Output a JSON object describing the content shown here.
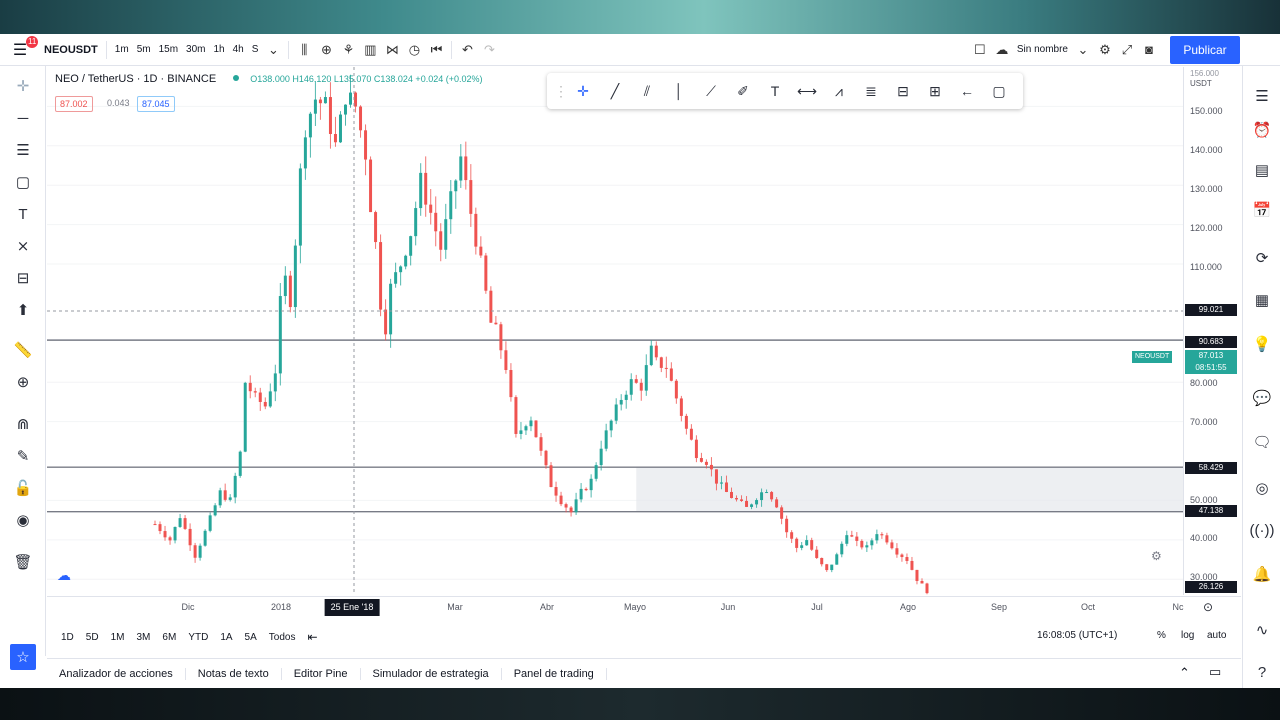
{
  "header": {
    "symbol": "NEOUSDT",
    "notification_count": "11",
    "intervals": [
      "1m",
      "5m",
      "15m",
      "30m",
      "1h",
      "4h",
      "S"
    ],
    "layout_name": "Sin nombre",
    "publish_label": "Publicar"
  },
  "legend": {
    "title": "NEO / TetherUS · 1D · BINANCE",
    "ohlc": "O138.000 H146.120 L135.070 C138.024 +0.024 (+0.02%)",
    "bid": "87.002",
    "spread": "0.043",
    "ask": "87.045"
  },
  "price_axis": {
    "currency": "USDT",
    "top_tag": "156.000",
    "labels": [
      "150.000",
      "140.000",
      "130.000",
      "120.000",
      "110.000",
      "80.000",
      "70.000",
      "50.000",
      "40.000",
      "30.000"
    ],
    "crosshair_price": "99.021",
    "level_tags": [
      "90.683",
      "58.429",
      "47.138"
    ],
    "bottom_tag": "26.126",
    "last_price": "87.013",
    "countdown": "08:51:55",
    "symbol_tag": "NEOUSDT"
  },
  "time_axis": {
    "labels": [
      "Dic",
      "2018",
      "Mar",
      "Abr",
      "Mayo",
      "Jun",
      "Jul",
      "Ago",
      "Sep",
      "Oct",
      "Nc"
    ],
    "crosshair_date": "25 Ene '18"
  },
  "range_bar": {
    "ranges": [
      "1D",
      "5D",
      "1M",
      "3M",
      "6M",
      "YTD",
      "1A",
      "5A",
      "Todos"
    ],
    "clock": "16:08:05 (UTC+1)",
    "percent_label": "%",
    "log_label": "log",
    "auto_label": "auto"
  },
  "bottom_tabs": [
    "Analizador de acciones",
    "Notas de texto",
    "Editor Pine",
    "Simulador de estrategia",
    "Panel de trading"
  ],
  "colors": {
    "up": "#26a69a",
    "down": "#ef5350",
    "accent": "#2962ff",
    "badge": "#f23645"
  },
  "chart_data": {
    "type": "candlestick",
    "ylim": [
      26,
      160
    ],
    "x_labels": [
      "Dic",
      "2018",
      "Mar",
      "Abr",
      "Mayo",
      "Jun",
      "Jul",
      "Ago",
      "Sep",
      "Oct",
      "Nc"
    ],
    "horizontal_levels": [
      90.683,
      58.429,
      47.138
    ],
    "shaded_zone": [
      47.138,
      58.429
    ],
    "price_path": [
      [
        0,
        44
      ],
      [
        3,
        40
      ],
      [
        5,
        46
      ],
      [
        8,
        36
      ],
      [
        10,
        42
      ],
      [
        13,
        52
      ],
      [
        15,
        50
      ],
      [
        17,
        62
      ],
      [
        18,
        80
      ],
      [
        20,
        76
      ],
      [
        22,
        74
      ],
      [
        24,
        83
      ],
      [
        25,
        100
      ],
      [
        26,
        106
      ],
      [
        27,
        101
      ],
      [
        28,
        116
      ],
      [
        29,
        133
      ],
      [
        30,
        145
      ],
      [
        32,
        152
      ],
      [
        34,
        150
      ],
      [
        36,
        140
      ],
      [
        37,
        146
      ],
      [
        38,
        153
      ],
      [
        40,
        150
      ],
      [
        42,
        138
      ],
      [
        43,
        125
      ],
      [
        44,
        115
      ],
      [
        45,
        100
      ],
      [
        46,
        94
      ],
      [
        47,
        104
      ],
      [
        49,
        110
      ],
      [
        51,
        118
      ],
      [
        53,
        131
      ],
      [
        55,
        123
      ],
      [
        57,
        114
      ],
      [
        59,
        126
      ],
      [
        61,
        137
      ],
      [
        63,
        123
      ],
      [
        65,
        110
      ],
      [
        67,
        95
      ],
      [
        68,
        93
      ],
      [
        70,
        84
      ],
      [
        72,
        66
      ],
      [
        74,
        70
      ],
      [
        75,
        71
      ],
      [
        77,
        62
      ],
      [
        79,
        54
      ],
      [
        81,
        50
      ],
      [
        83,
        47
      ],
      [
        85,
        52
      ],
      [
        87,
        55
      ],
      [
        89,
        64
      ],
      [
        91,
        70
      ],
      [
        93,
        76
      ],
      [
        95,
        80
      ],
      [
        97,
        79
      ],
      [
        99,
        88
      ],
      [
        100,
        85
      ],
      [
        102,
        84
      ],
      [
        104,
        76
      ],
      [
        106,
        68
      ],
      [
        108,
        62
      ],
      [
        110,
        60
      ],
      [
        112,
        55
      ],
      [
        114,
        52
      ],
      [
        116,
        50
      ],
      [
        118,
        48
      ],
      [
        120,
        51
      ],
      [
        122,
        53
      ],
      [
        124,
        49
      ],
      [
        126,
        42
      ],
      [
        128,
        38
      ],
      [
        130,
        40
      ],
      [
        132,
        35
      ],
      [
        134,
        32
      ],
      [
        136,
        36
      ],
      [
        138,
        42
      ],
      [
        140,
        39
      ],
      [
        142,
        38
      ],
      [
        144,
        42
      ],
      [
        146,
        40
      ],
      [
        148,
        37
      ],
      [
        150,
        35
      ],
      [
        152,
        30
      ],
      [
        154,
        27
      ]
    ],
    "day_count": 155
  }
}
